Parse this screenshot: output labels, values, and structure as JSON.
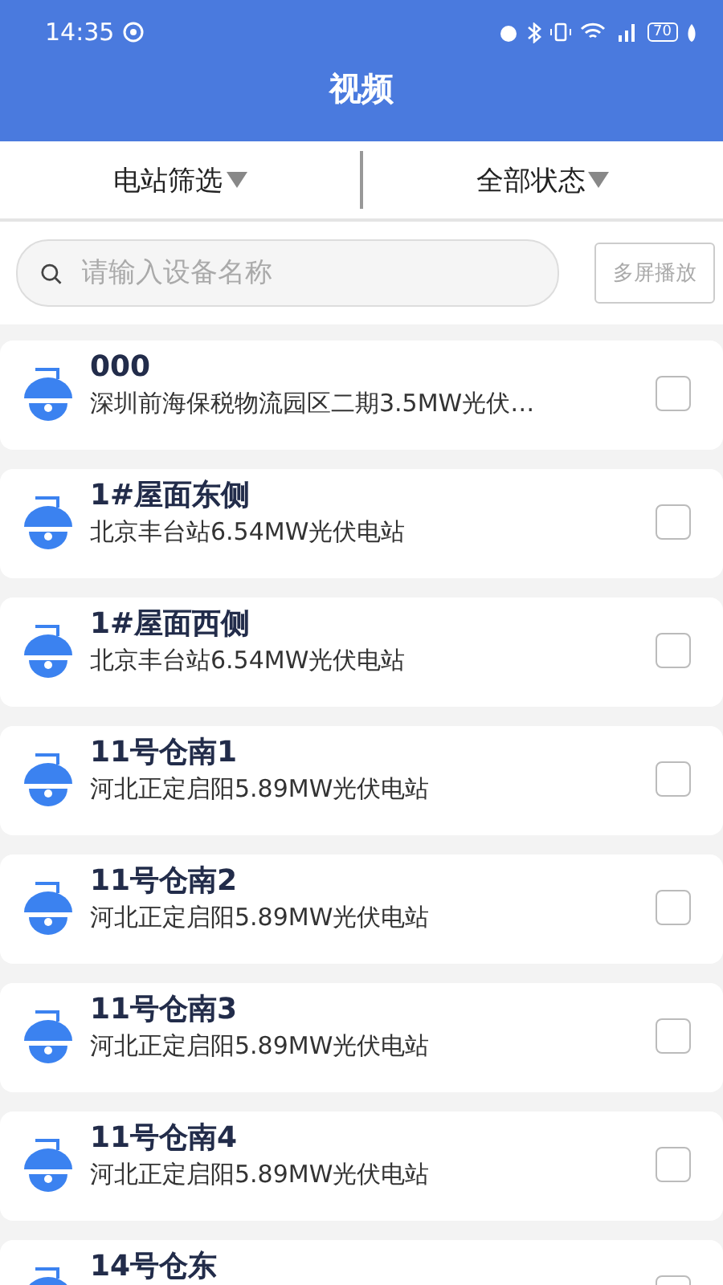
{
  "status_bar": {
    "time": "14:35",
    "battery": "70"
  },
  "header": {
    "title": "视频"
  },
  "filters": [
    {
      "label": "电站筛选"
    },
    {
      "label": "全部状态"
    }
  ],
  "search": {
    "placeholder": "请输入设备名称"
  },
  "multi_play_button": {
    "label": "多屏播放",
    "disabled": true
  },
  "devices": [
    {
      "name": "000",
      "station": "深圳前海保税物流园区二期3.5MW光伏…",
      "checked": false
    },
    {
      "name": "1#屋面东侧",
      "station": "北京丰台站6.54MW光伏电站",
      "checked": false
    },
    {
      "name": "1#屋面西侧",
      "station": "北京丰台站6.54MW光伏电站",
      "checked": false
    },
    {
      "name": "11号仓南1",
      "station": "河北正定启阳5.89MW光伏电站",
      "checked": false
    },
    {
      "name": "11号仓南2",
      "station": "河北正定启阳5.89MW光伏电站",
      "checked": false
    },
    {
      "name": "11号仓南3",
      "station": "河北正定启阳5.89MW光伏电站",
      "checked": false
    },
    {
      "name": "11号仓南4",
      "station": "河北正定启阳5.89MW光伏电站",
      "checked": false
    },
    {
      "name": "14号仓东",
      "checked": false
    }
  ]
}
